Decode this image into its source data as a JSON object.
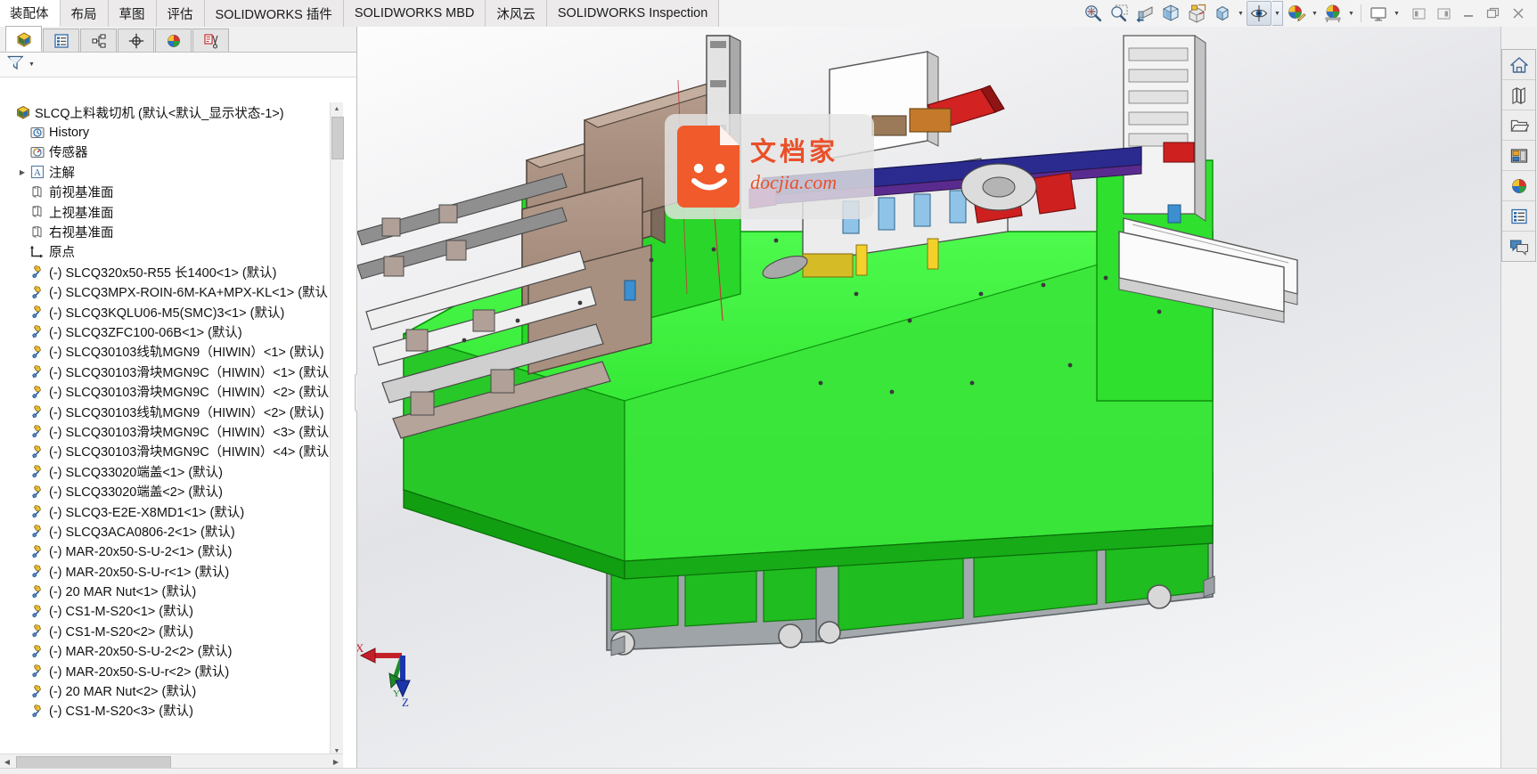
{
  "window": {
    "title": "SLCQ上料裁切机",
    "controls": [
      {
        "name": "restore-left",
        "glyph": "◧"
      },
      {
        "name": "restore-right",
        "glyph": "◨"
      },
      {
        "name": "minimize",
        "glyph": "—"
      },
      {
        "name": "restore",
        "glyph": "❐"
      },
      {
        "name": "close",
        "glyph": "✕"
      }
    ]
  },
  "ribbon": {
    "tabs": [
      {
        "label": "装配体",
        "active": true
      },
      {
        "label": "布局",
        "active": false
      },
      {
        "label": "草图",
        "active": false
      },
      {
        "label": "评估",
        "active": false
      },
      {
        "label": "SOLIDWORKS 插件",
        "active": false
      },
      {
        "label": "SOLIDWORKS MBD",
        "active": false
      },
      {
        "label": "沐风云",
        "active": false
      },
      {
        "label": "SOLIDWORKS Inspection",
        "active": false
      }
    ],
    "tools": [
      {
        "name": "zoom-to-fit-icon",
        "tip": "整屏显示全图"
      },
      {
        "name": "zoom-to-area-icon",
        "tip": "局部放大"
      },
      {
        "name": "previous-view-icon",
        "tip": "上一视图"
      },
      {
        "name": "section-view-icon",
        "tip": "剖面视图"
      },
      {
        "name": "view-orientation-icon",
        "tip": "视图定向"
      },
      {
        "name": "display-style-icon",
        "tip": "显示样式",
        "hasCaret": true
      },
      {
        "name": "hide-show-items-icon",
        "tip": "隐藏/显示项目",
        "hasCaret": true
      },
      {
        "name": "edit-appearance-icon",
        "tip": "编辑外观",
        "hasCaret": true
      },
      {
        "name": "apply-scene-icon",
        "tip": "应用布景",
        "hasCaret": true
      },
      {
        "name": "view-settings-icon",
        "tip": "视图设定",
        "hasCaret": true
      }
    ]
  },
  "featureManager": {
    "tabs": [
      {
        "name": "feature-tree-tab",
        "label": "FeatureManager 设计树",
        "active": true
      },
      {
        "name": "property-manager-tab",
        "label": "PropertyManager",
        "active": false
      },
      {
        "name": "configuration-manager-tab",
        "label": "ConfigurationManager",
        "active": false
      },
      {
        "name": "dimxpert-manager-tab",
        "label": "DimXpertManager",
        "active": false
      },
      {
        "name": "display-manager-tab",
        "label": "DisplayManager",
        "active": false
      },
      {
        "name": "cam-manager-tab",
        "label": "CAM",
        "active": false
      }
    ],
    "filter": {
      "name": "filter-icon",
      "placeholder": ""
    },
    "tree": [
      {
        "label": "SLCQ上料裁切机  (默认<默认_显示状态-1>)",
        "icon": "assembly-icon",
        "indent": 0,
        "twisty": ""
      },
      {
        "label": "History",
        "icon": "history-icon",
        "indent": 1,
        "twisty": ""
      },
      {
        "label": "传感器",
        "icon": "sensors-icon",
        "indent": 1,
        "twisty": ""
      },
      {
        "label": "注解",
        "icon": "annotations-icon",
        "indent": 1,
        "twisty": "▶"
      },
      {
        "label": "前视基准面",
        "icon": "plane-icon",
        "indent": 2,
        "twisty": ""
      },
      {
        "label": "上视基准面",
        "icon": "plane-icon",
        "indent": 2,
        "twisty": ""
      },
      {
        "label": "右视基准面",
        "icon": "plane-icon",
        "indent": 2,
        "twisty": ""
      },
      {
        "label": "原点",
        "icon": "origin-icon",
        "indent": 2,
        "twisty": ""
      },
      {
        "label": "(-) SLCQ320x50-R55 长1400<1> (默认)",
        "icon": "part-icon",
        "indent": 2,
        "twisty": ""
      },
      {
        "label": "(-) SLCQ3MPX-ROIN-6M-KA+MPX-KL<1> (默认",
        "icon": "part-icon",
        "indent": 2,
        "twisty": ""
      },
      {
        "label": "(-) SLCQ3KQLU06-M5(SMC)3<1> (默认)",
        "icon": "part-icon",
        "indent": 2,
        "twisty": ""
      },
      {
        "label": "(-) SLCQ3ZFC100-06B<1> (默认)",
        "icon": "part-icon",
        "indent": 2,
        "twisty": ""
      },
      {
        "label": "(-) SLCQ30103线轨MGN9（HIWIN）<1> (默认)",
        "icon": "part-icon",
        "indent": 2,
        "twisty": ""
      },
      {
        "label": "(-) SLCQ30103滑块MGN9C（HIWIN）<1> (默认",
        "icon": "part-icon",
        "indent": 2,
        "twisty": ""
      },
      {
        "label": "(-) SLCQ30103滑块MGN9C（HIWIN）<2> (默认",
        "icon": "part-icon",
        "indent": 2,
        "twisty": ""
      },
      {
        "label": "(-) SLCQ30103线轨MGN9（HIWIN）<2> (默认)",
        "icon": "part-icon",
        "indent": 2,
        "twisty": ""
      },
      {
        "label": "(-) SLCQ30103滑块MGN9C（HIWIN）<3> (默认",
        "icon": "part-icon",
        "indent": 2,
        "twisty": ""
      },
      {
        "label": "(-) SLCQ30103滑块MGN9C（HIWIN）<4> (默认",
        "icon": "part-icon",
        "indent": 2,
        "twisty": ""
      },
      {
        "label": "(-) SLCQ33020端盖<1> (默认)",
        "icon": "part-icon",
        "indent": 2,
        "twisty": ""
      },
      {
        "label": "(-) SLCQ33020端盖<2> (默认)",
        "icon": "part-icon",
        "indent": 2,
        "twisty": ""
      },
      {
        "label": "(-) SLCQ3-E2E-X8MD1<1> (默认)",
        "icon": "part-icon",
        "indent": 2,
        "twisty": ""
      },
      {
        "label": "(-) SLCQ3ACA0806-2<1> (默认)",
        "icon": "part-icon",
        "indent": 2,
        "twisty": ""
      },
      {
        "label": "(-) MAR-20x50-S-U-2<1> (默认)",
        "icon": "part-icon",
        "indent": 2,
        "twisty": ""
      },
      {
        "label": "(-) MAR-20x50-S-U-r<1> (默认)",
        "icon": "part-icon",
        "indent": 2,
        "twisty": ""
      },
      {
        "label": "(-) 20 MAR Nut<1> (默认)",
        "icon": "part-icon",
        "indent": 2,
        "twisty": ""
      },
      {
        "label": "(-) CS1-M-S20<1> (默认)",
        "icon": "part-icon",
        "indent": 2,
        "twisty": ""
      },
      {
        "label": "(-) CS1-M-S20<2> (默认)",
        "icon": "part-icon",
        "indent": 2,
        "twisty": ""
      },
      {
        "label": "(-) MAR-20x50-S-U-2<2> (默认)",
        "icon": "part-icon",
        "indent": 2,
        "twisty": ""
      },
      {
        "label": "(-) MAR-20x50-S-U-r<2> (默认)",
        "icon": "part-icon",
        "indent": 2,
        "twisty": ""
      },
      {
        "label": "(-) 20 MAR Nut<2> (默认)",
        "icon": "part-icon",
        "indent": 2,
        "twisty": ""
      },
      {
        "label": "(-) CS1-M-S20<3> (默认)",
        "icon": "part-icon",
        "indent": 2,
        "twisty": ""
      }
    ]
  },
  "viewport": {
    "watermark": {
      "cn": "文档家",
      "en": "docjia.com",
      "accent": "#ec5a2c"
    },
    "axes": {
      "x": "X",
      "y": "Y",
      "z": "Z"
    },
    "model_colors": {
      "frame_green": "#2ee52e",
      "panel_tan": "#a89080",
      "accent_red": "#d61f1f",
      "cabinet_green": "#1fb81f",
      "metal_grey": "#9a9a9a"
    }
  },
  "taskPane": {
    "buttons": [
      {
        "name": "sw-resources-icon",
        "label": "SOLIDWORKS 资源"
      },
      {
        "name": "design-library-icon",
        "label": "设计库"
      },
      {
        "name": "file-explorer-icon",
        "label": "文件探索器"
      },
      {
        "name": "view-palette-icon",
        "label": "视图调色板"
      },
      {
        "name": "appearances-scenes-icon",
        "label": "外观、布景和贴图"
      },
      {
        "name": "custom-properties-icon",
        "label": "自定义属性"
      },
      {
        "name": "sw-forum-icon",
        "label": "SOLIDWORKS 论坛"
      }
    ]
  }
}
